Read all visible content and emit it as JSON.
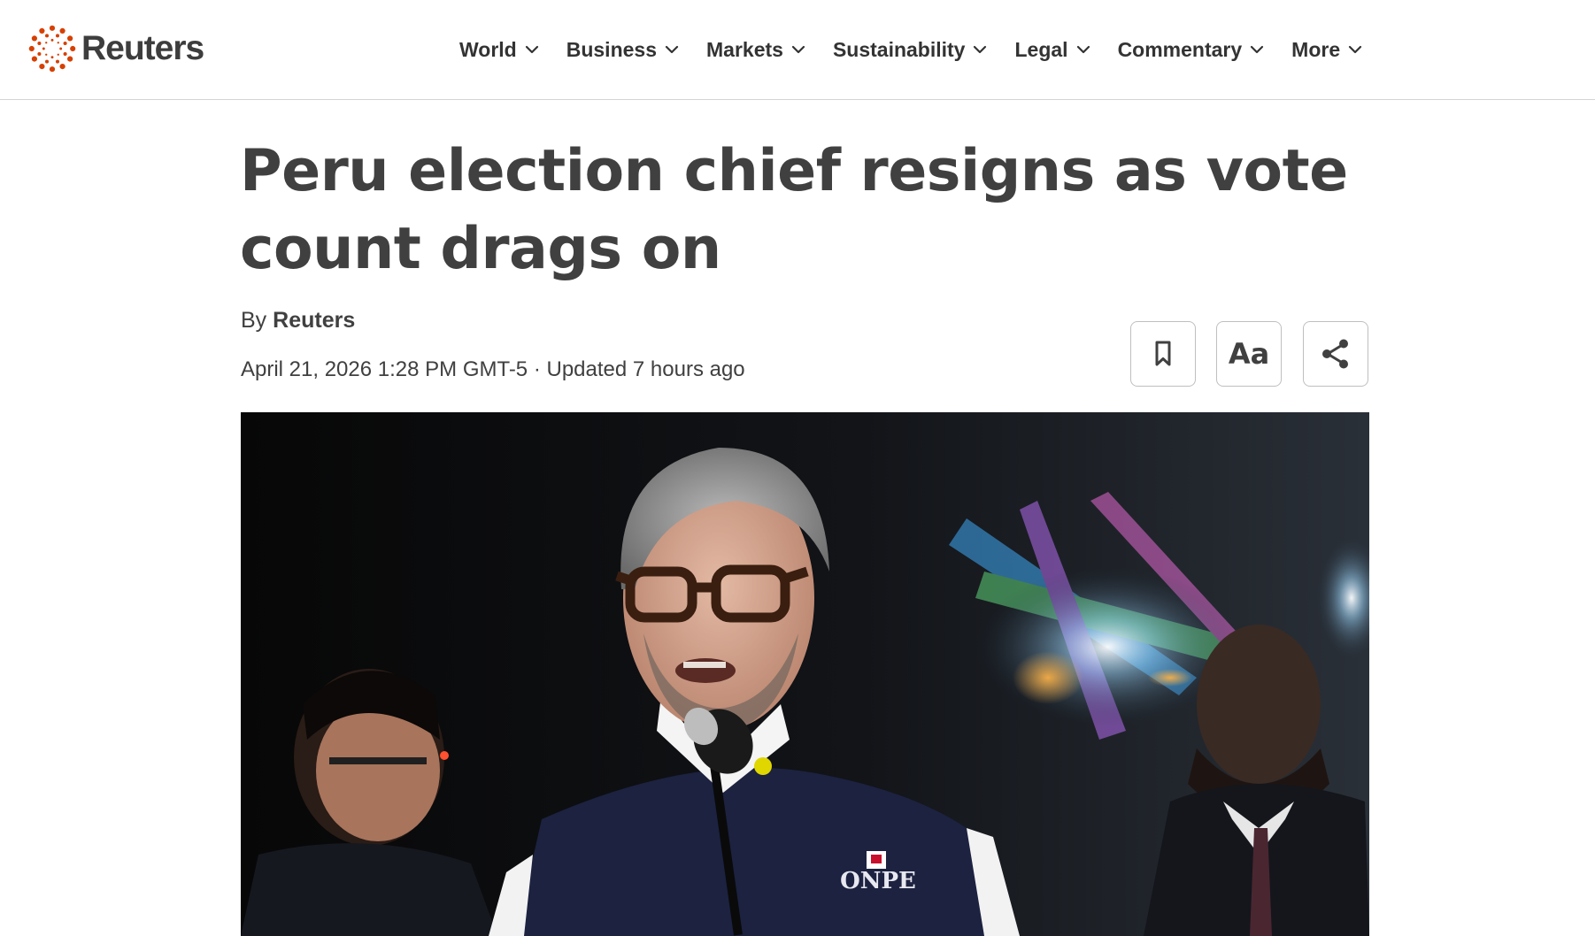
{
  "brand": {
    "name": "Reuters",
    "accent_color": "#d64000"
  },
  "nav": {
    "items": [
      {
        "label": "World"
      },
      {
        "label": "Business"
      },
      {
        "label": "Markets"
      },
      {
        "label": "Sustainability"
      },
      {
        "label": "Legal"
      },
      {
        "label": "Commentary"
      },
      {
        "label": "More"
      }
    ],
    "dropdown_icon": "chevron-down-icon"
  },
  "article": {
    "headline": "Peru election chief resigns as vote count drags on",
    "byline_prefix": "By",
    "author": "Reuters",
    "dateline": "April 21, 2026 1:28 PM GMT-5 · Updated 7 hours ago",
    "tools": {
      "bookmark_icon": "bookmark-icon",
      "font_size_label": "Aa",
      "share_icon": "share-icon"
    },
    "lead_image": {
      "vest_text": "ONPE"
    }
  }
}
